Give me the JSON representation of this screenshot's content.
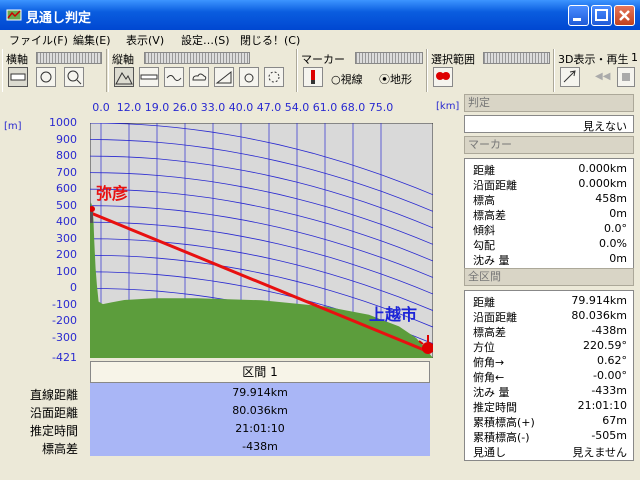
{
  "window": {
    "title": "見通し判定"
  },
  "menu": [
    "ファイル(F)",
    "編集(E)",
    "表示(V)",
    "設定…(S)",
    "閉じる！(C)"
  ],
  "toolbar": {
    "h_axis": "横軸",
    "v_axis": "縦軸",
    "marker": "マーカー",
    "radio_sight": "視線",
    "radio_terrain": "地形",
    "range": "選択範囲",
    "play3d": "3D表示・再生",
    "play3d_badge": "1"
  },
  "chart_data": {
    "type": "area",
    "x_unit": "[km]",
    "y_unit": "[m]",
    "x_ticks": [
      "0.0",
      "12.0",
      "19.0",
      "26.0",
      "33.0",
      "40.0",
      "47.0",
      "54.0",
      "61.0",
      "68.0",
      "75.0"
    ],
    "y_ticks": [
      "1000",
      "900",
      "800",
      "700",
      "600",
      "500",
      "400",
      "300",
      "200",
      "100",
      "0",
      "-100",
      "-200",
      "-300",
      "-421"
    ],
    "ylim": [
      -421,
      1000
    ],
    "xlim": [
      0,
      79.914
    ],
    "start_label": "弥彦",
    "end_label": "上越市",
    "sight_line": {
      "x": [
        0,
        79.914
      ],
      "y": [
        458,
        -421
      ]
    },
    "terrain": {
      "x": [
        0,
        0.2,
        0.5,
        0.8,
        1.0,
        1.3,
        1.6,
        2.0,
        3.0,
        5.0,
        8.0,
        15.0,
        25.0,
        40.0,
        55.0,
        65.0,
        72.0,
        76.0,
        78.0,
        79.914
      ],
      "y": [
        458,
        520,
        500,
        420,
        280,
        120,
        20,
        -80,
        -95,
        -85,
        -70,
        -60,
        -60,
        -72,
        -110,
        -160,
        -230,
        -300,
        -360,
        -421
      ]
    },
    "curve_levels": [
      1000,
      900,
      800,
      700,
      600,
      500,
      400,
      300,
      200,
      100,
      0,
      -100,
      -200,
      -300
    ]
  },
  "section": {
    "header": "区間 1",
    "labels": [
      "直線距離",
      "沿面距離",
      "推定時間",
      "標高差"
    ],
    "values": [
      "79.914km",
      "80.036km",
      "21:01:10",
      "-438m"
    ]
  },
  "right": {
    "judge_header": "判定",
    "judge_value": "見えない",
    "marker_header": "マーカー",
    "marker_rows": [
      {
        "k": "距離",
        "v": "0.000km"
      },
      {
        "k": "沿面距離",
        "v": "0.000km"
      },
      {
        "k": "標高",
        "v": "458m"
      },
      {
        "k": "標高差",
        "v": "0m"
      },
      {
        "k": "傾斜",
        "v": "0.0°"
      },
      {
        "k": "勾配",
        "v": "0.0%"
      },
      {
        "k": "沈み 量",
        "v": "0m"
      }
    ],
    "all_header": "全区間",
    "all_rows": [
      {
        "k": "距離",
        "v": "79.914km"
      },
      {
        "k": "沿面距離",
        "v": "80.036km"
      },
      {
        "k": "標高差",
        "v": "-438m"
      },
      {
        "k": "方位",
        "v": "220.59°"
      },
      {
        "k": "俯角→",
        "v": "0.62°"
      },
      {
        "k": "俯角←",
        "v": "-0.00°"
      },
      {
        "k": "沈み 量",
        "v": "-433m"
      },
      {
        "k": "推定時間",
        "v": "21:01:10"
      },
      {
        "k": "累積標高(+)",
        "v": "67m"
      },
      {
        "k": "累積標高(-)",
        "v": "-505m"
      },
      {
        "k": "見通し",
        "v": "見えません"
      }
    ]
  },
  "colors": {
    "accent": "#0a5ddf",
    "terrain": "#5c9d3c",
    "sight": "#e81010",
    "grid": "#2a2ad0",
    "section_bg": "#a9b6f6"
  }
}
